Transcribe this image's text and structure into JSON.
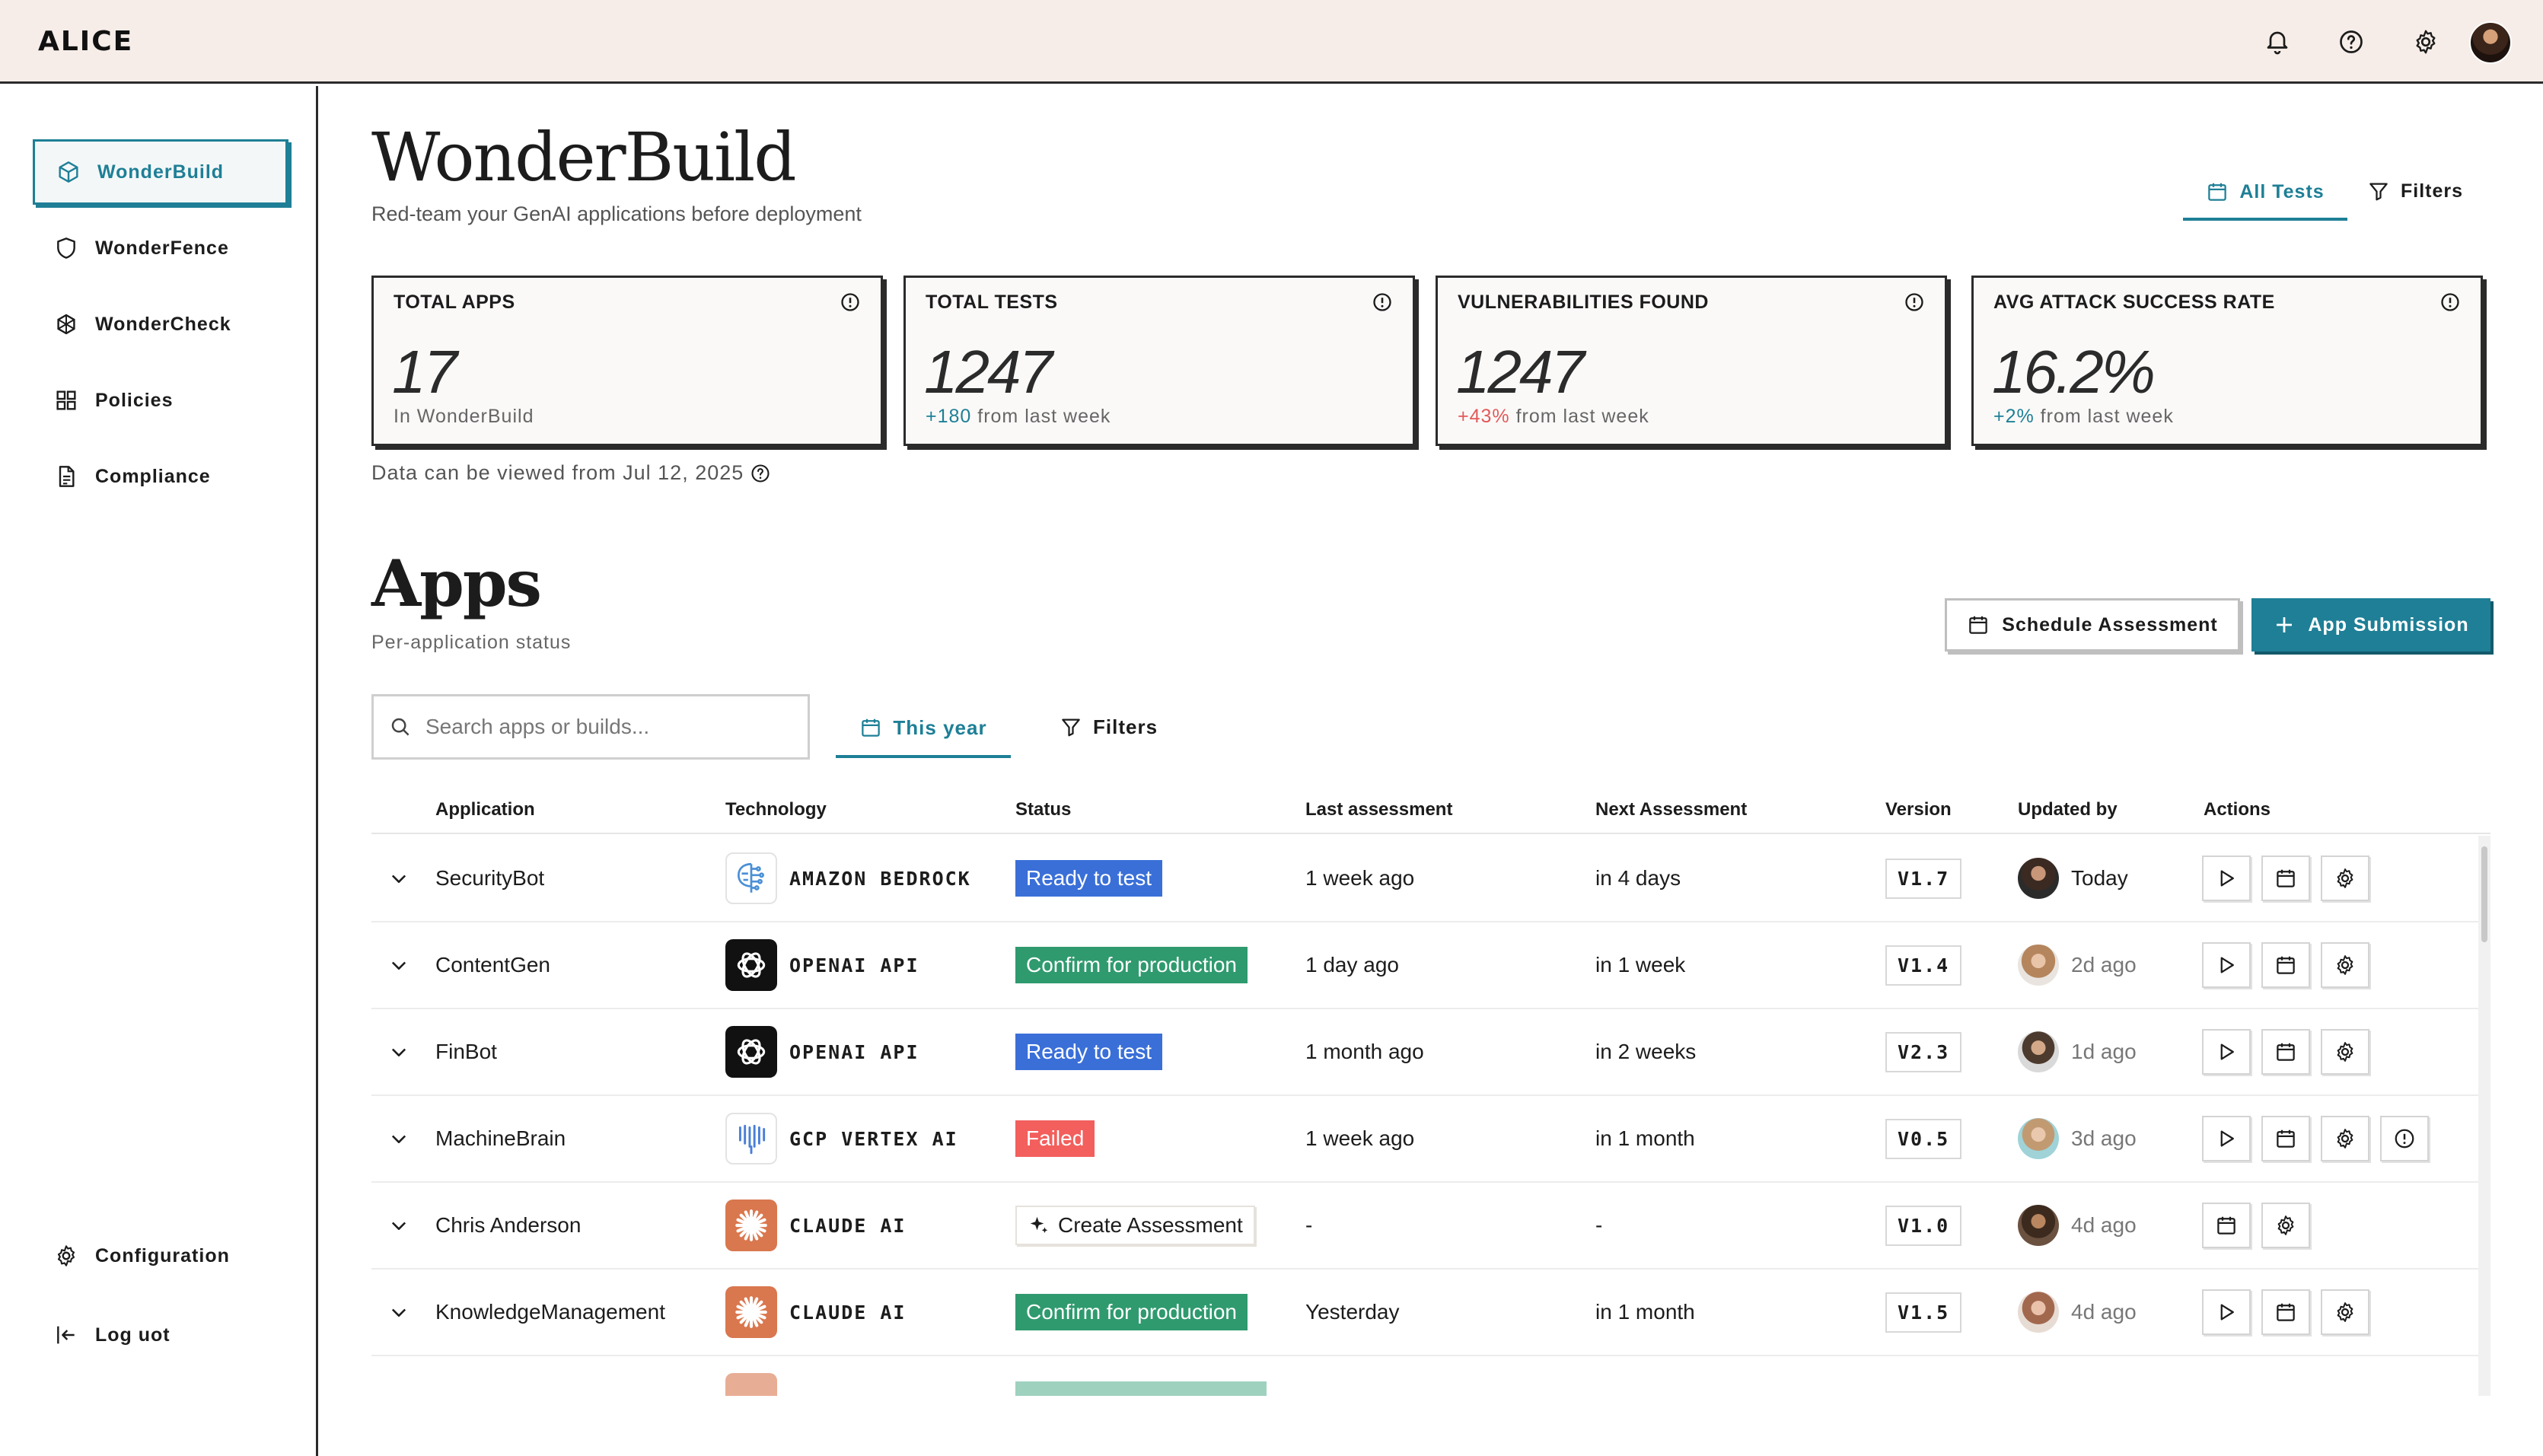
{
  "brand": "ALICE",
  "sidebar": {
    "items": [
      {
        "label": "WonderBuild",
        "icon": "cube-icon",
        "active": true
      },
      {
        "label": "WonderFence",
        "icon": "shield-icon",
        "active": false
      },
      {
        "label": "WonderCheck",
        "icon": "globe-check-icon",
        "active": false
      },
      {
        "label": "Policies",
        "icon": "grid-icon",
        "active": false
      },
      {
        "label": "Compliance",
        "icon": "document-icon",
        "active": false
      }
    ],
    "bottom": [
      {
        "label": "Configuration",
        "icon": "gear-icon"
      },
      {
        "label": "Log uot",
        "icon": "logout-icon"
      }
    ]
  },
  "page": {
    "title": "WonderBuild",
    "subtitle": "Red-team your GenAI applications before deployment",
    "tab_all": "All Tests",
    "tab_filters": "Filters"
  },
  "stats": [
    {
      "label": "TOTAL APPS",
      "value": "17",
      "foot": "In WonderBuild",
      "delta": ""
    },
    {
      "label": "TOTAL TESTS",
      "value": "1247",
      "delta": "+180",
      "foot": " from last week"
    },
    {
      "label": "VULNERABILITIES FOUND",
      "value": "1247",
      "delta": "+43%",
      "foot": " from last week"
    },
    {
      "label": "AVG ATTACK SUCCESS RATE",
      "value": "16.2%",
      "delta": "+2%",
      "foot": " from last week"
    }
  ],
  "data_note": "Data can be viewed from Jul 12, 2025",
  "apps": {
    "title": "Apps",
    "subtitle": "Per-application status",
    "schedule_button": "Schedule Assessment",
    "submit_button": "App Submission",
    "search_placeholder": "Search apps or builds...",
    "tab_year": "This year",
    "tab_filters": "Filters"
  },
  "table": {
    "columns": [
      "Application",
      "Technology",
      "Status",
      "Last assessment",
      "Next Assessment",
      "Version",
      "Updated by",
      "Actions"
    ],
    "rows": [
      {
        "app": "SecurityBot",
        "tech": "AMAZON BEDROCK",
        "tech_logo": "bedrock",
        "status": "Ready to test",
        "status_type": "ready",
        "last": "1 week ago",
        "next": "in 4 days",
        "version": "V1.7",
        "updated": "Today",
        "actions": [
          "play-icon",
          "calendar-icon",
          "gear-icon"
        ]
      },
      {
        "app": "ContentGen",
        "tech": "OPENAI API",
        "tech_logo": "openai",
        "status": "Confirm for production",
        "status_type": "confirm",
        "last": "1 day ago",
        "next": "in 1 week",
        "version": "V1.4",
        "updated": "2d ago",
        "actions": [
          "play-icon",
          "calendar-icon",
          "gear-icon"
        ]
      },
      {
        "app": "FinBot",
        "tech": "OPENAI API",
        "tech_logo": "openai",
        "status": "Ready to test",
        "status_type": "ready",
        "last": "1 month ago",
        "next": "in 2 weeks",
        "version": "V2.3",
        "updated": "1d ago",
        "actions": [
          "play-icon",
          "calendar-icon",
          "gear-icon"
        ]
      },
      {
        "app": "MachineBrain",
        "tech": "GCP VERTEX AI",
        "tech_logo": "gcp",
        "status": "Failed",
        "status_type": "failed",
        "last": "1 week ago",
        "next": "in 1 month",
        "version": "V0.5",
        "updated": "3d ago",
        "actions": [
          "play-icon",
          "calendar-icon",
          "gear-icon",
          "alert-icon"
        ]
      },
      {
        "app": "Chris Anderson",
        "tech": "CLAUDE AI",
        "tech_logo": "claude",
        "status": "Create Assessment",
        "status_type": "create",
        "last": "-",
        "next": "-",
        "version": "V1.0",
        "updated": "4d ago",
        "actions": [
          "calendar-icon",
          "gear-icon"
        ]
      },
      {
        "app": "KnowledgeManagement",
        "tech": "CLAUDE AI",
        "tech_logo": "claude",
        "status": "Confirm for production",
        "status_type": "confirm",
        "last": "Yesterday",
        "next": "in 1 month",
        "version": "V1.5",
        "updated": "4d ago",
        "actions": [
          "play-icon",
          "calendar-icon",
          "gear-icon"
        ]
      }
    ]
  },
  "colors": {
    "accent": "#1e7f96",
    "ready": "#3a6fd8",
    "confirm": "#2f9a6e",
    "failed": "#f25f5c",
    "topbar": "#f7ede8"
  }
}
